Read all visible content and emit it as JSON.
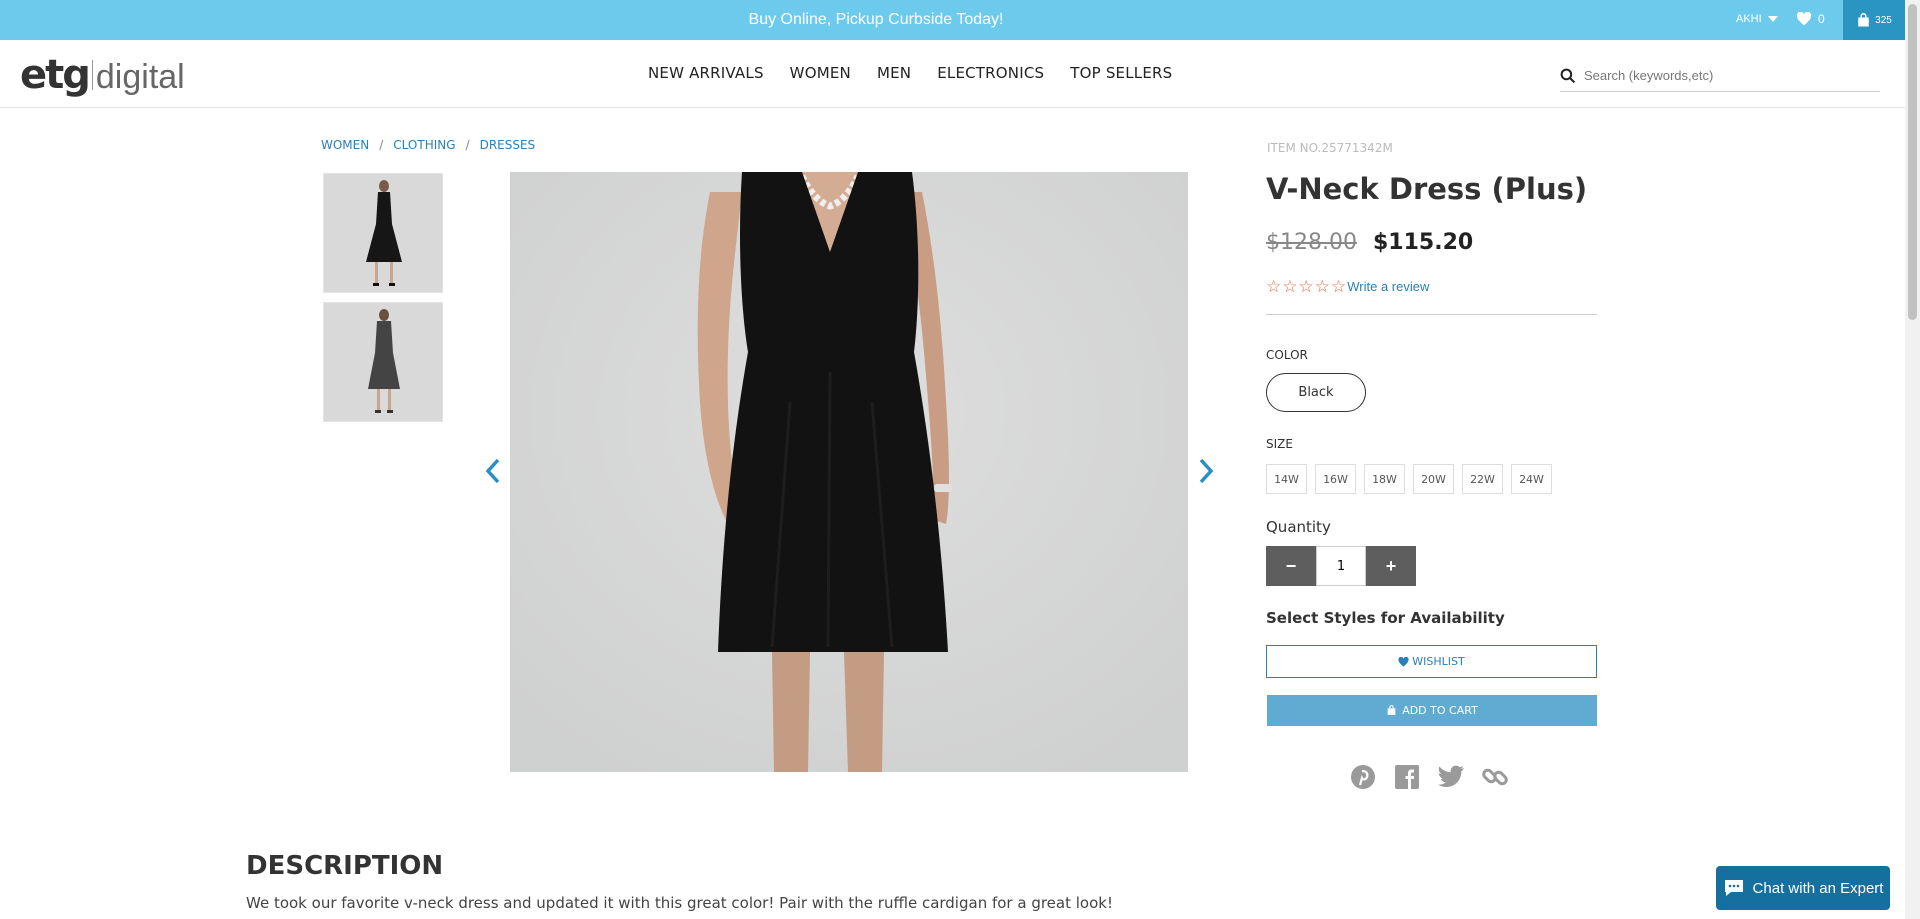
{
  "promo": {
    "text": "Buy Online, Pickup Curbside Today!"
  },
  "account": {
    "name": "AKHI",
    "wishlist_count": "0",
    "cart_count": "325"
  },
  "logo": {
    "part1": "etg",
    "part2": "digital"
  },
  "nav": {
    "items": [
      "NEW ARRIVALS",
      "WOMEN",
      "MEN",
      "ELECTRONICS",
      "TOP SELLERS"
    ]
  },
  "search": {
    "placeholder": "Search (keywords,etc)"
  },
  "breadcrumb": {
    "items": [
      "WOMEN",
      "CLOTHING",
      "DRESSES"
    ],
    "separator": "/"
  },
  "product": {
    "item_no": "ITEM NO.25771342M",
    "title": "V-Neck Dress (Plus)",
    "old_price": "$128.00",
    "new_price": "$115.20",
    "stars": [
      "☆",
      "☆",
      "☆",
      "☆",
      "☆"
    ],
    "review_link": "Write a review",
    "color_label": "COLOR",
    "color_value": "Black",
    "size_label": "SIZE",
    "sizes": [
      "14W",
      "16W",
      "18W",
      "20W",
      "22W",
      "24W"
    ],
    "quantity_label": "Quantity",
    "quantity_value": "1",
    "qty_minus": "−",
    "qty_plus": "+",
    "availability_label": "Select Styles for Availability",
    "wishlist_btn": "WISHLIST",
    "cart_btn": "ADD TO CART"
  },
  "description": {
    "title": "DESCRIPTION",
    "text": "We took our favorite v-neck dress and updated it with this great color! Pair with the ruffle cardigan for a great look!"
  },
  "chat": {
    "label": "Chat with an Expert"
  },
  "colors": {
    "promo_bg": "#6ccbec",
    "cart_bg": "#2b95c1",
    "link": "#2b7fb4",
    "star": "#e46d3b",
    "add_to_cart": "#5fabd1",
    "chat": "#15709f"
  }
}
